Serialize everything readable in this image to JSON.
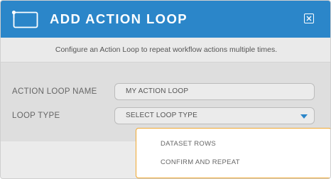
{
  "dialog": {
    "title": "ADD ACTION LOOP",
    "subtitle": "Configure an Action Loop to repeat workflow actions multiple times.",
    "header_color": "#2b86c9",
    "close_icon": "close-icon"
  },
  "form": {
    "name_label": "ACTION LOOP NAME",
    "name_value": "MY ACTION LOOP",
    "type_label": "LOOP TYPE",
    "type_placeholder": "SELECT LOOP TYPE"
  },
  "dropdown": {
    "options": [
      "DATASET ROWS",
      "CONFIRM AND REPEAT"
    ],
    "border_color": "#f0a830"
  }
}
